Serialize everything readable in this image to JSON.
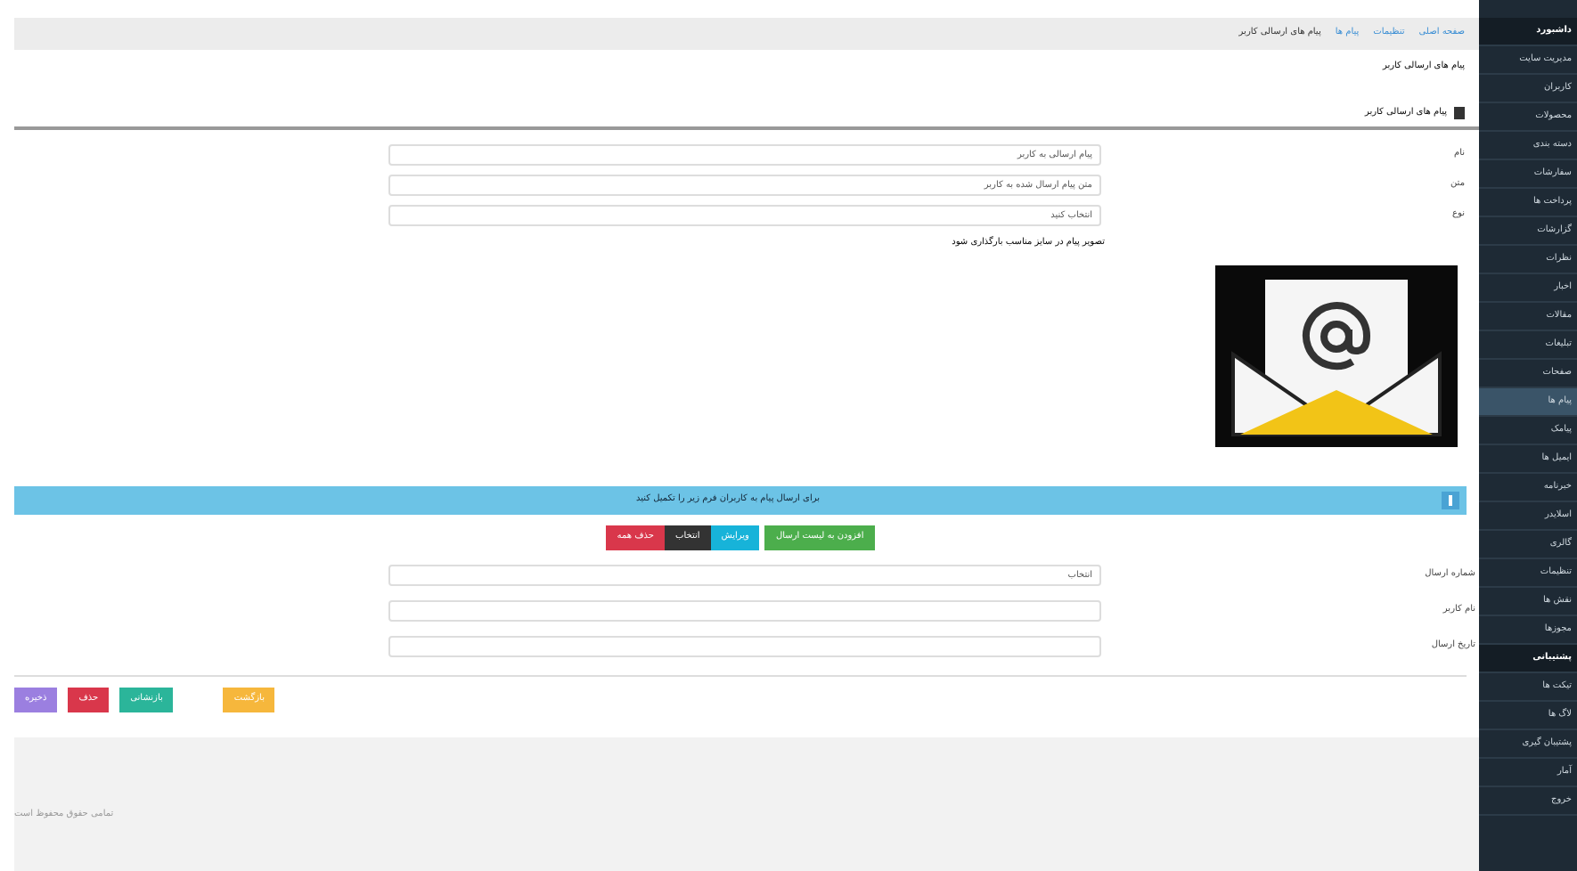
{
  "breadcrumb": [
    {
      "label": "صفحه اصلی",
      "selected": false
    },
    {
      "label": "تنظیمات",
      "selected": false
    },
    {
      "label": "پیام ها",
      "selected": false
    },
    {
      "label": "پیام های ارسالی کاربر",
      "selected": true
    }
  ],
  "page_title": "پیام های ارسالی کاربر",
  "section_title": "پیام های ارسالی کاربر",
  "fields": [
    {
      "label": "نام",
      "value": "پیام ارسالی به کاربر"
    },
    {
      "label": "متن",
      "value": "متن پیام ارسال شده به کاربر"
    },
    {
      "label": "نوع",
      "value": "انتخاب کنید"
    }
  ],
  "image_caption": "تصویر پیام در سایز مناسب بارگذاری شود",
  "info_bar": "برای ارسال پیام به کاربران فرم زیر را تکمیل کنید",
  "action_buttons": [
    {
      "label": "افزودن به لیست ارسال",
      "kind": "green"
    },
    {
      "label": "ویرایش",
      "kind": "cyan"
    },
    {
      "label": "انتخاب",
      "kind": "dark"
    },
    {
      "label": "حذف همه",
      "kind": "red"
    }
  ],
  "fields2": [
    {
      "label": "شماره ارسال",
      "value": "انتخاب"
    },
    {
      "label": "نام کاربر"
    },
    {
      "label": "تاریخ ارسال"
    }
  ],
  "bottom_buttons": [
    {
      "label": "بازگشت",
      "kind": "orange"
    },
    {
      "label": "بازنشانی",
      "kind": "teal"
    },
    {
      "label": "حذف",
      "kind": "red"
    },
    {
      "label": "ذخیره",
      "kind": "purple"
    }
  ],
  "footer": "تمامی حقوق محفوظ است",
  "sidebar": [
    {
      "label": "داشبورد",
      "selected": false,
      "header": true
    },
    {
      "label": "مدیریت سایت",
      "selected": false,
      "header": false
    },
    {
      "label": "کاربران",
      "selected": false,
      "header": false
    },
    {
      "label": "محصولات",
      "selected": false,
      "header": false
    },
    {
      "label": "دسته بندی",
      "selected": false,
      "header": false
    },
    {
      "label": "سفارشات",
      "selected": false,
      "header": false
    },
    {
      "label": "پرداخت ها",
      "selected": false,
      "header": false
    },
    {
      "label": "گزارشات",
      "selected": false,
      "header": false
    },
    {
      "label": "نظرات",
      "selected": false,
      "header": false
    },
    {
      "label": "اخبار",
      "selected": false,
      "header": false
    },
    {
      "label": "مقالات",
      "selected": false,
      "header": false
    },
    {
      "label": "تبلیغات",
      "selected": false,
      "header": false
    },
    {
      "label": "صفحات",
      "selected": false,
      "header": false
    },
    {
      "label": "پیام ها",
      "selected": true,
      "header": false
    },
    {
      "label": "پیامک",
      "selected": false,
      "header": false
    },
    {
      "label": "ایمیل ها",
      "selected": false,
      "header": false
    },
    {
      "label": "خبرنامه",
      "selected": false,
      "header": false
    },
    {
      "label": "اسلایدر",
      "selected": false,
      "header": false
    },
    {
      "label": "گالری",
      "selected": false,
      "header": false
    },
    {
      "label": "تنظیمات",
      "selected": false,
      "header": false
    },
    {
      "label": "نقش ها",
      "selected": false,
      "header": false
    },
    {
      "label": "مجوزها",
      "selected": false,
      "header": false
    },
    {
      "label": "پشتیبانی",
      "selected": false,
      "header": true
    },
    {
      "label": "تیکت ها",
      "selected": false,
      "header": false
    },
    {
      "label": "لاگ ها",
      "selected": false,
      "header": false
    },
    {
      "label": "پشتیبان گیری",
      "selected": false,
      "header": false
    },
    {
      "label": "آمار",
      "selected": false,
      "header": false
    },
    {
      "label": "خروج",
      "selected": false,
      "header": false
    }
  ]
}
